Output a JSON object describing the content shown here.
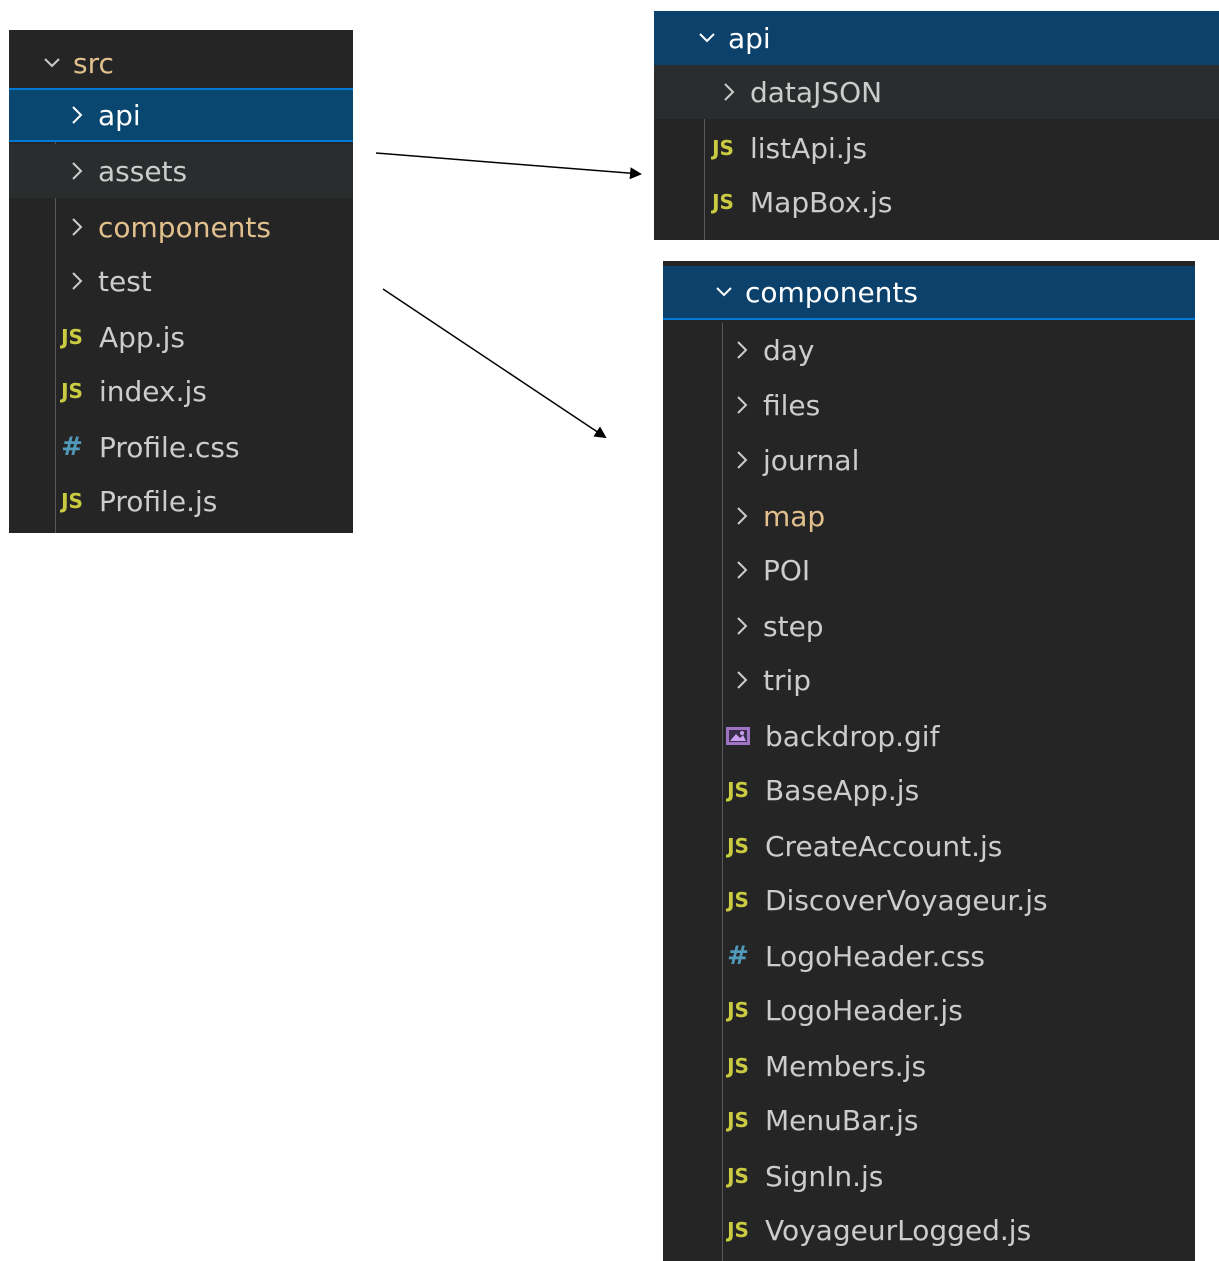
{
  "src_panel": {
    "header": "src",
    "items": [
      {
        "label": "api",
        "kind": "folder",
        "state": "selected"
      },
      {
        "label": "assets",
        "kind": "folder",
        "state": "hover"
      },
      {
        "label": "components",
        "kind": "folder",
        "state": "modified"
      },
      {
        "label": "test",
        "kind": "folder",
        "state": "normal"
      },
      {
        "label": "App.js",
        "kind": "js"
      },
      {
        "label": "index.js",
        "kind": "js"
      },
      {
        "label": "Profile.css",
        "kind": "css"
      },
      {
        "label": "Profile.js",
        "kind": "js"
      }
    ]
  },
  "api_panel": {
    "header": "api",
    "items": [
      {
        "label": "dataJSON",
        "kind": "folder"
      },
      {
        "label": "listApi.js",
        "kind": "js"
      },
      {
        "label": "MapBox.js",
        "kind": "js"
      }
    ]
  },
  "components_panel": {
    "header": "components",
    "items": [
      {
        "label": "day",
        "kind": "folder"
      },
      {
        "label": "files",
        "kind": "folder"
      },
      {
        "label": "journal",
        "kind": "folder"
      },
      {
        "label": "map",
        "kind": "folder",
        "state": "modified"
      },
      {
        "label": "POI",
        "kind": "folder"
      },
      {
        "label": "step",
        "kind": "folder"
      },
      {
        "label": "trip",
        "kind": "folder"
      },
      {
        "label": "backdrop.gif",
        "kind": "image"
      },
      {
        "label": "BaseApp.js",
        "kind": "js"
      },
      {
        "label": "CreateAccount.js",
        "kind": "js"
      },
      {
        "label": "DiscoverVoyageur.js",
        "kind": "js"
      },
      {
        "label": "LogoHeader.css",
        "kind": "css"
      },
      {
        "label": "LogoHeader.js",
        "kind": "js"
      },
      {
        "label": "Members.js",
        "kind": "js"
      },
      {
        "label": "MenuBar.js",
        "kind": "js"
      },
      {
        "label": "SignIn.js",
        "kind": "js"
      },
      {
        "label": "VoyageurLogged.js",
        "kind": "js"
      }
    ]
  },
  "icons": {
    "js_text": "JS",
    "css_text": "#"
  },
  "colors": {
    "panel_bg": "#252526",
    "selected_bg": "#094771",
    "selected_border": "#0078d4",
    "js_icon": "#cbcb41",
    "css_icon": "#519aba",
    "modified_text": "#e2c08d"
  }
}
